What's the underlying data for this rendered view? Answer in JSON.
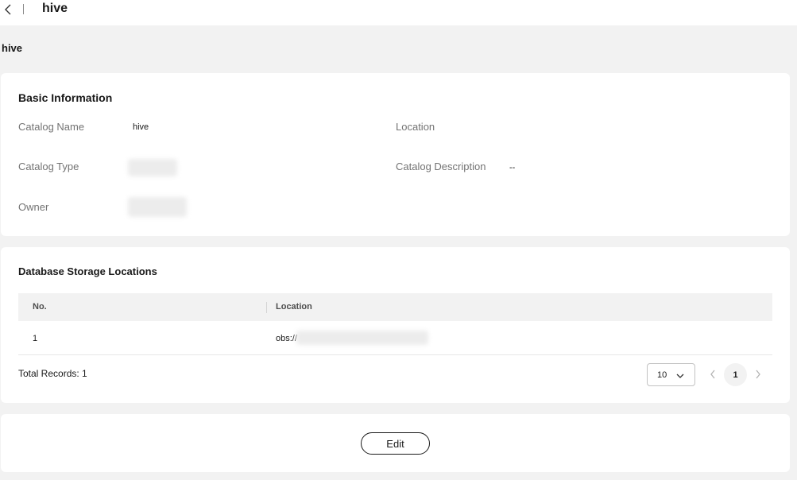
{
  "header": {
    "title": "hive"
  },
  "subtitle": "hive",
  "basic_info": {
    "title": "Basic Information",
    "catalog_name_label": "Catalog Name",
    "catalog_name_value": "hive",
    "location_label": "Location",
    "location_value": "",
    "catalog_type_label": "Catalog Type",
    "catalog_description_label": "Catalog Description",
    "catalog_description_value": "--",
    "owner_label": "Owner"
  },
  "storage": {
    "title": "Database Storage Locations",
    "columns": [
      "No.",
      "Location"
    ],
    "rows": [
      {
        "no": "1",
        "location": "obs://"
      }
    ],
    "total_records": "Total Records: 1",
    "page_size": "10",
    "current_page": "1"
  },
  "actions": {
    "edit_label": "Edit"
  },
  "icons": {
    "back": "chevron-left-icon",
    "page_size_dropdown": "chevron-down-icon",
    "prev_page": "chevron-left-icon",
    "next_page": "chevron-right-icon"
  },
  "colors": {
    "page_background": "#f2f2f2",
    "card_background": "#ffffff",
    "text_primary": "#191919",
    "text_secondary": "#737373"
  }
}
